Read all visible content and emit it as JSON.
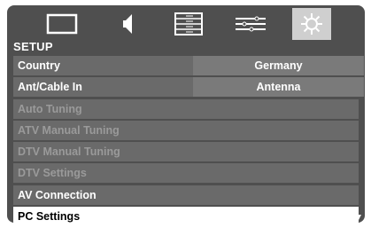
{
  "menu": {
    "tabs": [
      {
        "icon": "picture-icon"
      },
      {
        "icon": "sound-icon"
      },
      {
        "icon": "channel-list-icon"
      },
      {
        "icon": "preferences-sliders-icon"
      },
      {
        "icon": "setup-gear-icon",
        "active": true
      }
    ],
    "title": "SETUP",
    "rows": [
      {
        "label": "Country",
        "value": "Germany"
      },
      {
        "label": "Ant/Cable In",
        "value": "Antenna"
      },
      {
        "label": "Auto Tuning"
      },
      {
        "label": "ATV Manual Tuning"
      },
      {
        "label": "DTV Manual Tuning"
      },
      {
        "label": "DTV Settings"
      },
      {
        "label": "AV Connection"
      },
      {
        "label": "PC Settings"
      }
    ]
  },
  "colors": {
    "panel": "#4f4f4f",
    "row": "#6a6a6a",
    "value_box": "#7a7a7a",
    "selected_row": "#ffffff",
    "disabled_text": "#9a9a9a"
  }
}
